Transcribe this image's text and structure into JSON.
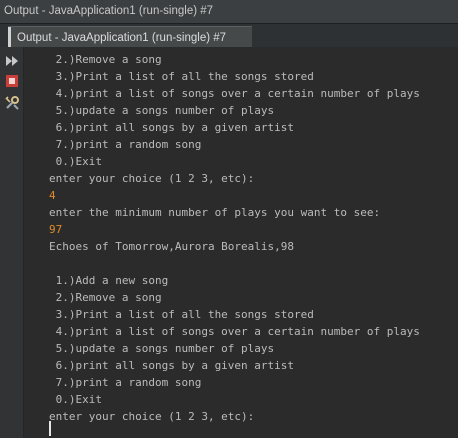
{
  "window": {
    "title": "Output - JavaApplication1 (run-single) #7"
  },
  "tab": {
    "label": "Output - JavaApplication1 (run-single) #7"
  },
  "sidebar": {
    "buttons": [
      {
        "icon": "rerun-icon",
        "color": "#c8c8c8"
      },
      {
        "icon": "stop-icon",
        "color": "#d9534f"
      },
      {
        "icon": "settings-icon",
        "color": "#d6c08c"
      }
    ]
  },
  "console": {
    "lines": [
      {
        "text": " 2.)Remove a song",
        "kind": "output"
      },
      {
        "text": " 3.)Print a list of all the songs stored",
        "kind": "output"
      },
      {
        "text": " 4.)print a list of songs over a certain number of plays",
        "kind": "output"
      },
      {
        "text": " 5.)update a songs number of plays",
        "kind": "output"
      },
      {
        "text": " 6.)print all songs by a given artist",
        "kind": "output"
      },
      {
        "text": " 7.)print a random song",
        "kind": "output"
      },
      {
        "text": " 0.)Exit",
        "kind": "output"
      },
      {
        "text": "enter your choice (1 2 3, etc):",
        "kind": "output"
      },
      {
        "text": "4",
        "kind": "input"
      },
      {
        "text": "enter the minimum number of plays you want to see:",
        "kind": "output"
      },
      {
        "text": "97",
        "kind": "input"
      },
      {
        "text": "Echoes of Tomorrow,Aurora Borealis,98",
        "kind": "output"
      },
      {
        "text": "",
        "kind": "output"
      },
      {
        "text": " 1.)Add a new song",
        "kind": "output"
      },
      {
        "text": " 2.)Remove a song",
        "kind": "output"
      },
      {
        "text": " 3.)Print a list of all the songs stored",
        "kind": "output"
      },
      {
        "text": " 4.)print a list of songs over a certain number of plays",
        "kind": "output"
      },
      {
        "text": " 5.)update a songs number of plays",
        "kind": "output"
      },
      {
        "text": " 6.)print all songs by a given artist",
        "kind": "output"
      },
      {
        "text": " 7.)print a random song",
        "kind": "output"
      },
      {
        "text": " 0.)Exit",
        "kind": "output"
      },
      {
        "text": "enter your choice (1 2 3, etc):",
        "kind": "output"
      }
    ]
  },
  "colors": {
    "background": "#2b2b2b",
    "output_text": "#bbbbbb",
    "input_text": "#e08b2b"
  }
}
